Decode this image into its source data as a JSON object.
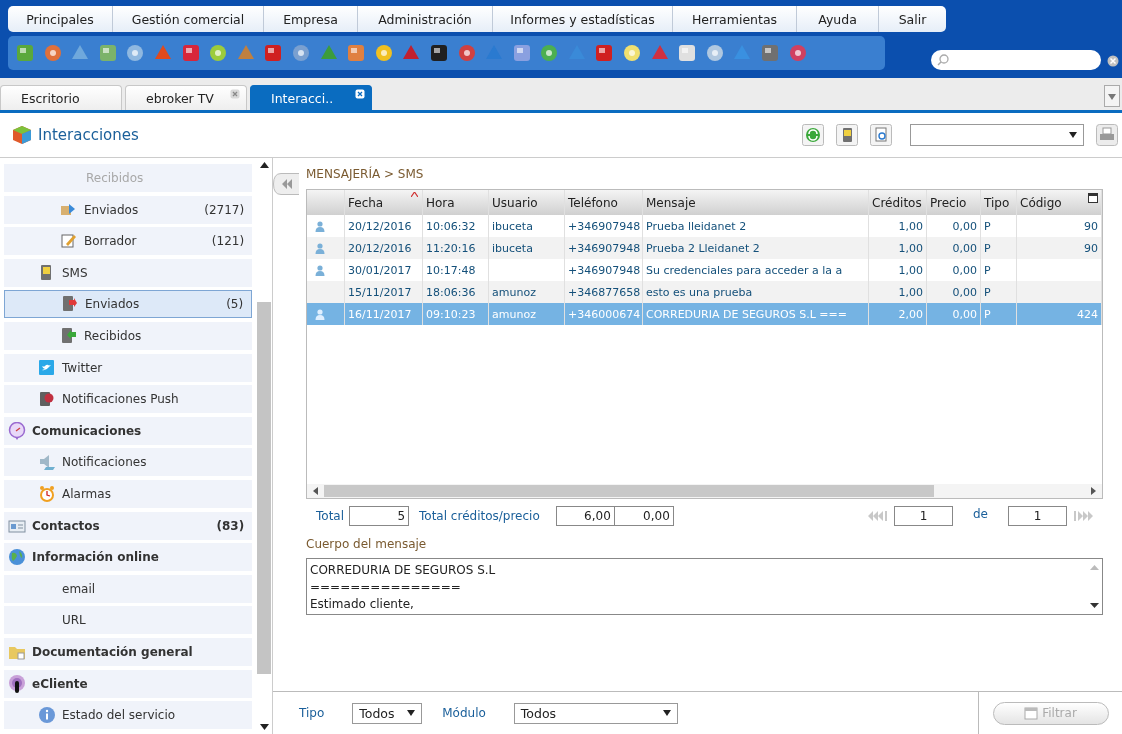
{
  "menu": [
    "Principales",
    "Gestión comercial",
    "Empresa",
    "Administración",
    "Informes y estadísticas",
    "Herramientas",
    "Ayuda",
    "Salir"
  ],
  "tabs": [
    {
      "label": "Escritorio",
      "selected": false,
      "closable": false
    },
    {
      "label": "ebroker TV",
      "selected": false,
      "closable": true
    },
    {
      "label": "Interacci..",
      "selected": true,
      "closable": true
    }
  ],
  "header": {
    "title": "Interacciones"
  },
  "sidebar": {
    "items": [
      {
        "children": [
          {
            "children": [
              {
                "label": "Recibidos",
                "kind": "none",
                "disabled": true,
                "selected": false
              },
              {
                "label": "Enviados",
                "count": "(2717)",
                "kind": "send",
                "disabled": false,
                "selected": false
              },
              {
                "label": "Borrador",
                "count": "(121)",
                "kind": "draft",
                "disabled": false,
                "selected": false
              }
            ]
          },
          {
            "label": "SMS",
            "kind": "phone",
            "disabled": false,
            "selected": false,
            "children": [
              {
                "label": "Enviados",
                "count": "(5)",
                "kind": "phone-out",
                "disabled": false,
                "selected": true
              },
              {
                "label": "Recibidos",
                "kind": "phone-in",
                "disabled": false,
                "selected": false
              }
            ]
          },
          {
            "label": "Twitter",
            "kind": "bird",
            "disabled": false,
            "selected": false
          },
          {
            "label": "Notificaciones Push",
            "kind": "push",
            "disabled": false,
            "selected": false
          }
        ]
      },
      {
        "label": "Comunicaciones",
        "kind": "bubble",
        "disabled": false,
        "selected": false,
        "children": [
          {
            "label": "Notificaciones",
            "kind": "speaker",
            "disabled": false,
            "selected": false
          },
          {
            "label": "Alarmas",
            "kind": "clock",
            "disabled": false,
            "selected": false
          }
        ]
      },
      {
        "label": "Contactos",
        "count": "(83)",
        "kind": "card",
        "disabled": false,
        "selected": false
      },
      {
        "label": "Información online",
        "kind": "globe",
        "disabled": false,
        "selected": false,
        "children": [
          {
            "label": "email",
            "kind": "none",
            "disabled": false,
            "selected": false
          },
          {
            "label": "URL",
            "kind": "none",
            "disabled": false,
            "selected": false
          }
        ]
      },
      {
        "label": "Documentación general",
        "kind": "folder",
        "disabled": false,
        "selected": false
      },
      {
        "label": "eCliente",
        "kind": "signal",
        "disabled": false,
        "selected": false,
        "children": [
          {
            "label": "Estado del servicio",
            "kind": "info",
            "disabled": false,
            "selected": false
          }
        ]
      }
    ]
  },
  "breadcrumb": "MENSAJERÍA > SMS",
  "table": {
    "columns": [
      {
        "label": "Fecha",
        "sorted": true
      },
      {
        "label": "Hora",
        "sorted": false
      },
      {
        "label": "Usuario",
        "sorted": false
      },
      {
        "label": "Teléfono",
        "sorted": false
      },
      {
        "label": "Mensaje",
        "sorted": false
      },
      {
        "label": "Créditos",
        "sorted": false
      },
      {
        "label": "Precio",
        "sorted": false
      },
      {
        "label": "Tipo",
        "sorted": false
      },
      {
        "label": "Código",
        "sorted": false
      }
    ],
    "rows": [
      {
        "user_icon": true,
        "selected": false,
        "cells": [
          "20/12/2016",
          "10:06:32",
          "ibuceta",
          "+346907948",
          "Prueba lleidanet 2",
          "1,00",
          "0,00",
          "P",
          "90"
        ]
      },
      {
        "user_icon": true,
        "selected": false,
        "cells": [
          "20/12/2016",
          "11:20:16",
          "ibuceta",
          "+346907948",
          "Prueba 2 Lleidanet 2",
          "1,00",
          "0,00",
          "P",
          "90"
        ]
      },
      {
        "user_icon": true,
        "selected": false,
        "cells": [
          "30/01/2017",
          "10:17:48",
          "",
          "+346907948",
          "Su credenciales para acceder a la a",
          "1,00",
          "0,00",
          "P",
          ""
        ]
      },
      {
        "user_icon": false,
        "selected": false,
        "cells": [
          "15/11/2017",
          "18:06:36",
          "amunoz",
          "+346877658",
          "esto es una prueba",
          "1,00",
          "0,00",
          "P",
          ""
        ]
      },
      {
        "user_icon": true,
        "selected": true,
        "cells": [
          "16/11/2017",
          "09:10:23",
          "amunoz",
          "+346000674",
          "CORREDURIA DE SEGUROS S.L ===",
          "2,00",
          "0,00",
          "P",
          "424"
        ]
      }
    ]
  },
  "totals": {
    "total_label": "Total",
    "total": "5",
    "credits_label": "Total créditos/precio",
    "credits": "6,00",
    "price": "0,00",
    "page": "1",
    "of_label": "de",
    "pages": "1"
  },
  "message_body": {
    "label": "Cuerpo del mensaje",
    "lines": [
      "CORREDURIA DE SEGUROS S.L",
      "===============",
      "Estimado cliente,"
    ]
  },
  "filter": {
    "type_label": "Tipo",
    "type_value": "Todos",
    "module_label": "Módulo",
    "module_value": "Todos",
    "button": "Filtrar",
    "button_disabled": true
  }
}
